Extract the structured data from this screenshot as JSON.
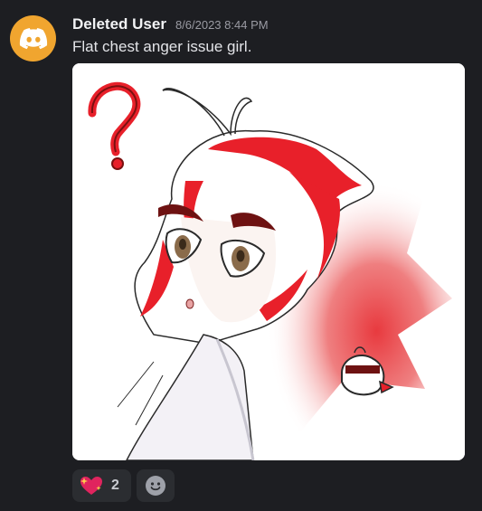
{
  "message": {
    "username": "Deleted User",
    "timestamp": "8/6/2023 8:44 PM",
    "content": "Flat chest anger issue girl.",
    "avatar_icon": "discord-logo-icon",
    "avatar_color": "#f0a52f"
  },
  "attachment": {
    "kind": "image",
    "subject": "anime-girl-illustration",
    "palette": [
      "#ffffff",
      "#e8202a",
      "#222222"
    ]
  },
  "reactions": [
    {
      "emoji": "sparkling-heart-icon",
      "count": "2"
    }
  ],
  "add_reaction_icon": "smiley-face-icon"
}
